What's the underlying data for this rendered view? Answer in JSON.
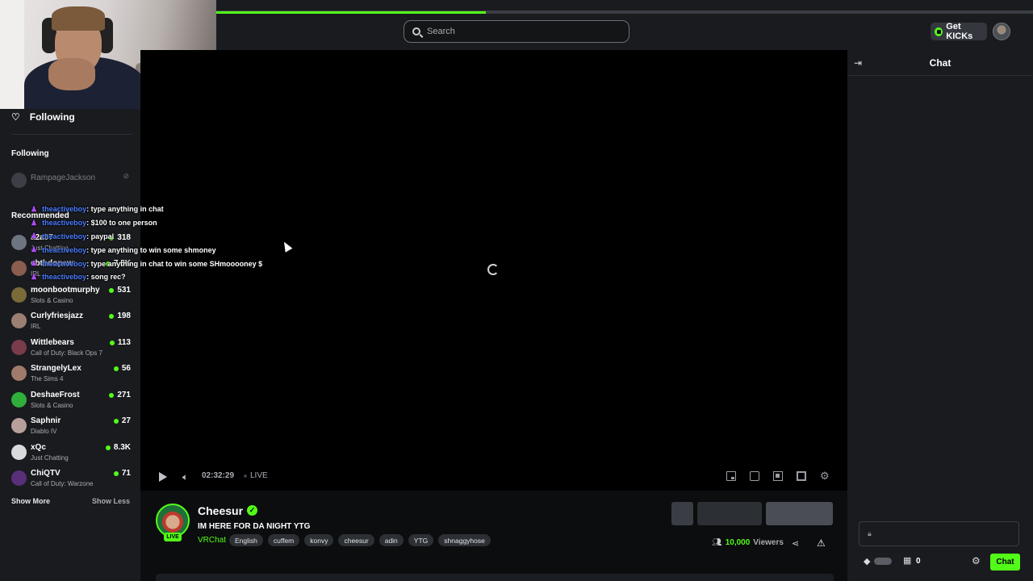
{
  "search": {
    "placeholder": "Search"
  },
  "header": {
    "get_kicks_label": "Get KICKs"
  },
  "sidebar": {
    "following_top_label": "Following",
    "following_section_label": "Following",
    "following": [
      {
        "name": "RampageJackson",
        "status": "offline"
      }
    ],
    "recommended_section_label": "Recommended",
    "recommended": [
      {
        "name": "a2a97",
        "category": "Just Chatting",
        "viewers": "318"
      },
      {
        "name": "ebthdopew",
        "category": "IRL",
        "viewers": "7.5K"
      },
      {
        "name": "moonbootmurphy",
        "category": "Slots & Casino",
        "viewers": "531"
      },
      {
        "name": "Curlyfriesjazz",
        "category": "IRL",
        "viewers": "198"
      },
      {
        "name": "Wittlebears",
        "category": "Call of Duty: Black Ops 7",
        "viewers": "113"
      },
      {
        "name": "StrangelyLex",
        "category": "The Sims 4",
        "viewers": "56"
      },
      {
        "name": "DeshaeFrost",
        "category": "Slots & Casino",
        "viewers": "271"
      },
      {
        "name": "Saphnir",
        "category": "Diablo IV",
        "viewers": "27"
      },
      {
        "name": "xQc",
        "category": "Just Chatting",
        "viewers": "8.3K"
      },
      {
        "name": "ChiQTV",
        "category": "Call of Duty: Warzone",
        "viewers": "71"
      }
    ],
    "show_more_label": "Show More",
    "show_less_label": "Show Less"
  },
  "chat_overlay": [
    {
      "user": "theactiveboy",
      "message": ": type anything in chat"
    },
    {
      "user": "theactiveboy",
      "message": ": $100 to one person"
    },
    {
      "user": "theactiveboy",
      "message": ": paypal"
    },
    {
      "user": "theactiveboy",
      "message": ": type anything to win some shmoney"
    },
    {
      "user": "theactiveboy",
      "message": ": type anything in chat to win some SHmooooney $"
    },
    {
      "user": "theactiveboy",
      "message": ": song rec?"
    }
  ],
  "player": {
    "time": "02:32:29",
    "live_label": "LIVE",
    "progress_fraction": 0.33,
    "icons": [
      "play-icon",
      "volume-icon",
      "pip-icon",
      "clip-icon",
      "theater-icon",
      "fullscreen-icon",
      "gear-icon"
    ]
  },
  "stream": {
    "streamer_name": "Cheesur",
    "live_badge": "LIVE",
    "title": "IM HERE FOR DA NIGHT YTG",
    "category": "VRChat",
    "tags": [
      "English",
      "cuffem",
      "konvy",
      "cheesur",
      "adin",
      "YTG",
      "shnaggyhose"
    ],
    "viewer_count": "10,000",
    "viewer_label": "Viewers"
  },
  "chat_panel": {
    "title": "Chat",
    "store_count": "0",
    "send_label": "Chat"
  },
  "colors": {
    "accent": "#53fc18",
    "background": "#0b0d0e",
    "panel": "#191b1f",
    "chat_username": "#4a7cff"
  }
}
